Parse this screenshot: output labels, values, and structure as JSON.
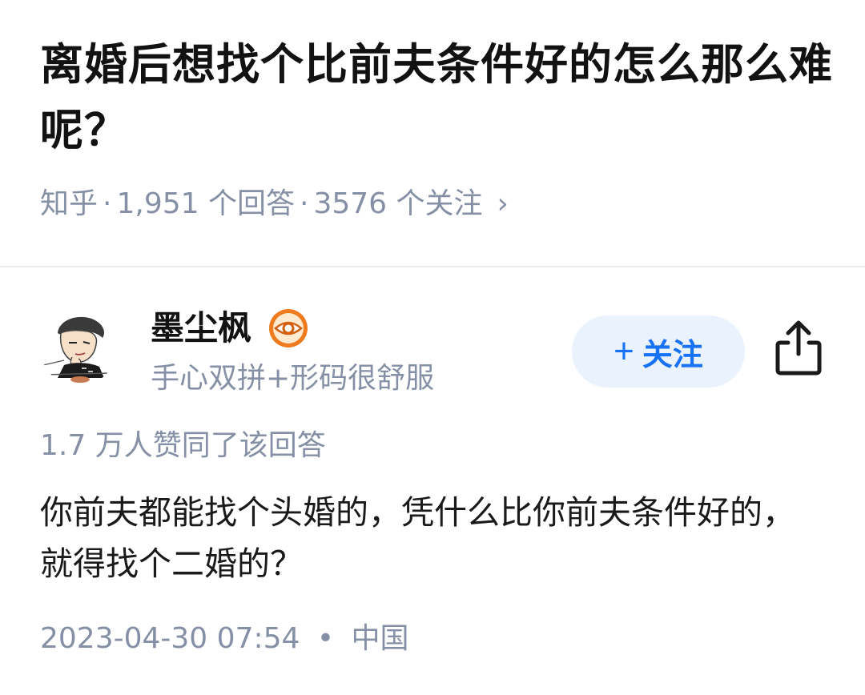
{
  "question": {
    "title": "离婚后想找个比前夫条件好的怎么那么难呢？",
    "source": "知乎",
    "separator": "·",
    "answers_count": "1,951 个回答",
    "followers_count": "3576 个关注",
    "chevron": "›"
  },
  "answer": {
    "author": {
      "name": "墨尘枫",
      "bio": "手心双拼+形码很舒服",
      "badge_icon": "eye-badge-icon",
      "avatar_icon": "cartoon-avatar"
    },
    "follow_button": {
      "plus": "+",
      "label": "关注"
    },
    "share_icon": "share-icon",
    "votes_text": "1.7 万人赞同了该回答",
    "content": "你前夫都能找个头婚的，凭什么比你前夫条件好的，就得找个二婚的？",
    "date": "2023-04-30 07:54",
    "dot": "•",
    "location": "中国"
  },
  "colors": {
    "meta_gray": "#8590a6",
    "title_black": "#121212",
    "accent_blue": "#1772f6",
    "follow_bg": "#eaf2fe",
    "badge_orange": "#f07a1e",
    "divider": "#ececec"
  }
}
